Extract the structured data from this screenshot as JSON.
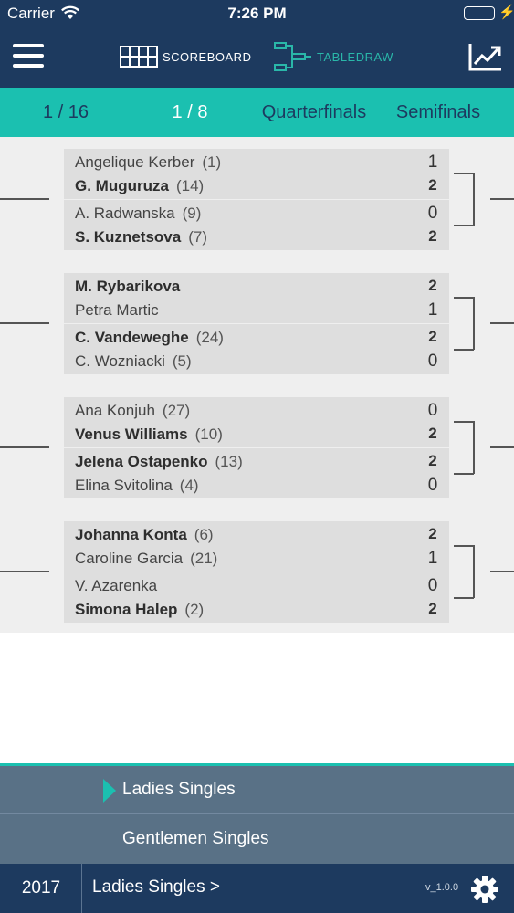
{
  "status_bar": {
    "carrier": "Carrier",
    "time": "7:26 PM"
  },
  "nav": {
    "scoreboard_label": "SCOREBOARD",
    "tabledraw_label": "TABLEDRAW",
    "active_tab": "TABLEDRAW"
  },
  "rounds": {
    "items": [
      "1 / 16",
      "1 / 8",
      "Quarterfinals",
      "Semifinals"
    ],
    "active": "1 / 8"
  },
  "matches": [
    {
      "p1": {
        "name": "Angelique Kerber",
        "seed": "(1)",
        "score": "1",
        "winner": false
      },
      "p2": {
        "name": "G. Muguruza",
        "seed": "(14)",
        "score": "2",
        "winner": true
      },
      "p3": {
        "name": "A. Radwanska",
        "seed": "(9)",
        "score": "0",
        "winner": false
      },
      "p4": {
        "name": "S. Kuznetsova",
        "seed": "(7)",
        "score": "2",
        "winner": true
      }
    },
    {
      "p1": {
        "name": "M. Rybarikova",
        "seed": "",
        "score": "2",
        "winner": true
      },
      "p2": {
        "name": "Petra Martic",
        "seed": "",
        "score": "1",
        "winner": false
      },
      "p3": {
        "name": "C. Vandeweghe",
        "seed": "(24)",
        "score": "2",
        "winner": true
      },
      "p4": {
        "name": "C. Wozniacki",
        "seed": "(5)",
        "score": "0",
        "winner": false
      }
    },
    {
      "p1": {
        "name": "Ana Konjuh",
        "seed": "(27)",
        "score": "0",
        "winner": false
      },
      "p2": {
        "name": "Venus Williams",
        "seed": "(10)",
        "score": "2",
        "winner": true
      },
      "p3": {
        "name": "Jelena Ostapenko",
        "seed": "(13)",
        "score": "2",
        "winner": true
      },
      "p4": {
        "name": "Elina Svitolina",
        "seed": "(4)",
        "score": "0",
        "winner": false
      }
    },
    {
      "p1": {
        "name": "Johanna Konta",
        "seed": "(6)",
        "score": "2",
        "winner": true
      },
      "p2": {
        "name": "Caroline Garcia",
        "seed": "(21)",
        "score": "1",
        "winner": false
      },
      "p3": {
        "name": "V. Azarenka",
        "seed": "",
        "score": "0",
        "winner": false
      },
      "p4": {
        "name": "Simona Halep",
        "seed": "(2)",
        "score": "2",
        "winner": true
      }
    }
  ],
  "events": {
    "items": [
      "Ladies Singles",
      "Gentlemen Singles"
    ],
    "selected": "Ladies Singles"
  },
  "footer": {
    "year": "2017",
    "event_label": "Ladies Singles >",
    "version": "v_1.0.0"
  },
  "colors": {
    "navy": "#1d3a5f",
    "teal": "#1bc0b0",
    "panel": "#597186",
    "row_bg": "#dedede"
  }
}
